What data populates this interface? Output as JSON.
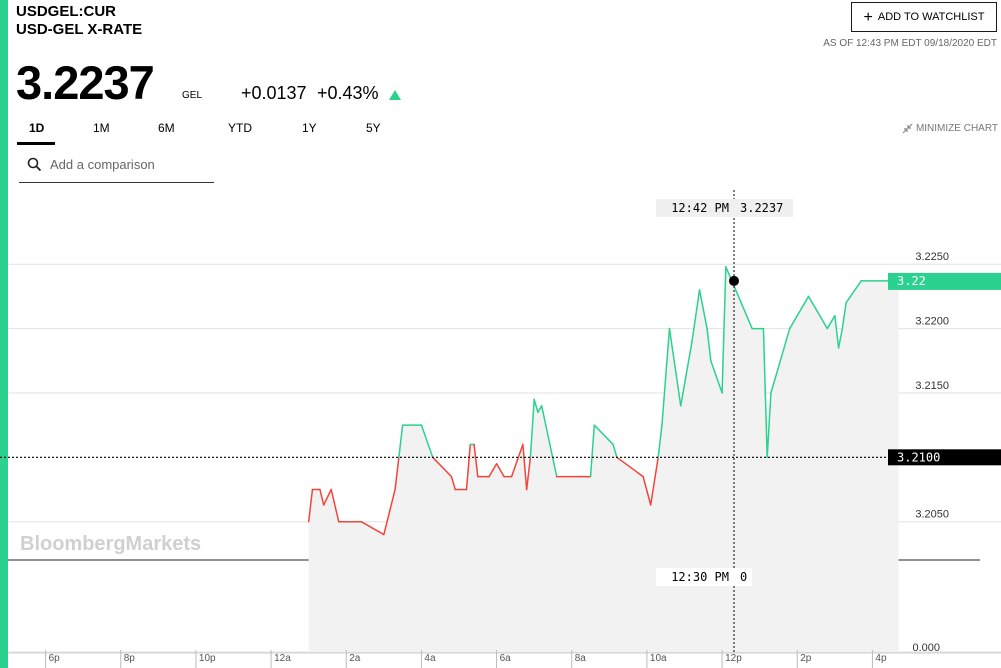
{
  "header": {
    "ticker": "USDGEL:CUR",
    "name": "USD-GEL X-RATE",
    "watchlist_label": "ADD TO WATCHLIST",
    "as_of": "AS OF 12:43 PM EDT 09/18/2020 EDT"
  },
  "quote": {
    "price": "3.2237",
    "currency": "GEL",
    "change": "+0.0137",
    "change_pct": "+0.43%"
  },
  "ranges": [
    "1D",
    "1M",
    "6M",
    "YTD",
    "1Y",
    "5Y"
  ],
  "active_range": "1D",
  "minimize_label": "MINIMIZE CHART",
  "compare": {
    "placeholder": "Add a comparison"
  },
  "colors": {
    "accent": "#2bd18f",
    "up": "#2bd18f",
    "down": "#f4433a"
  },
  "chart_data": {
    "type": "line",
    "watermark": "BloombergMarkets",
    "x_ticks": [
      "6p",
      "8p",
      "10p",
      "12a",
      "2a",
      "4a",
      "6a",
      "8a",
      "10a",
      "12p",
      "2p",
      "4p"
    ],
    "x_range_hours": [
      17,
      41
    ],
    "y_ticks": [
      "3.2250",
      "3.2200",
      "3.2150",
      "3.2050"
    ],
    "y_zero_label": "0.000",
    "y_range": [
      3.2035,
      3.2275
    ],
    "reference_value": 3.21,
    "reference_label": "3.2100",
    "last_label": "3.22",
    "crosshair_top": {
      "time": "12:42 PM",
      "value": "3.2237"
    },
    "crosshair_bottom": {
      "time": "12:30 PM",
      "value": "0"
    },
    "series": [
      {
        "points": [
          [
            25.0,
            3.205
          ],
          [
            25.1,
            3.2075
          ],
          [
            25.3,
            3.2075
          ],
          [
            25.4,
            3.2063
          ],
          [
            25.6,
            3.2075
          ],
          [
            25.8,
            3.205
          ],
          [
            26.4,
            3.205
          ],
          [
            27.0,
            3.204
          ],
          [
            27.3,
            3.2075
          ],
          [
            27.4,
            3.21
          ],
          [
            27.5,
            3.2125
          ],
          [
            28.0,
            3.2125
          ],
          [
            28.3,
            3.21
          ],
          [
            28.8,
            3.2085
          ],
          [
            28.9,
            3.2075
          ],
          [
            29.2,
            3.2075
          ],
          [
            29.3,
            3.211
          ],
          [
            29.4,
            3.211
          ],
          [
            29.5,
            3.2085
          ],
          [
            29.8,
            3.2085
          ],
          [
            30.0,
            3.2095
          ],
          [
            30.2,
            3.2085
          ],
          [
            30.4,
            3.2085
          ],
          [
            30.7,
            3.211
          ],
          [
            30.8,
            3.2075
          ],
          [
            30.9,
            3.21
          ],
          [
            31.0,
            3.2145
          ],
          [
            31.1,
            3.2135
          ],
          [
            31.2,
            3.214
          ],
          [
            31.6,
            3.2085
          ],
          [
            32.5,
            3.2085
          ],
          [
            32.6,
            3.2125
          ],
          [
            33.1,
            3.211
          ],
          [
            33.2,
            3.21
          ],
          [
            33.9,
            3.2085
          ],
          [
            34.1,
            3.2063
          ],
          [
            34.3,
            3.21
          ],
          [
            34.4,
            3.2125
          ],
          [
            34.6,
            3.22
          ],
          [
            34.9,
            3.214
          ],
          [
            35.2,
            3.219
          ],
          [
            35.4,
            3.223
          ],
          [
            35.6,
            3.22
          ],
          [
            35.7,
            3.2175
          ],
          [
            36.0,
            3.215
          ],
          [
            36.1,
            3.2248
          ],
          [
            36.8,
            3.22
          ],
          [
            37.1,
            3.22
          ],
          [
            37.2,
            3.21
          ],
          [
            37.3,
            3.215
          ],
          [
            37.8,
            3.22
          ],
          [
            38.3,
            3.2225
          ],
          [
            38.8,
            3.22
          ],
          [
            39.0,
            3.221
          ],
          [
            39.1,
            3.2185
          ],
          [
            39.2,
            3.22
          ],
          [
            39.3,
            3.222
          ],
          [
            39.7,
            3.2237
          ],
          [
            40.7,
            3.2237
          ]
        ]
      }
    ]
  }
}
